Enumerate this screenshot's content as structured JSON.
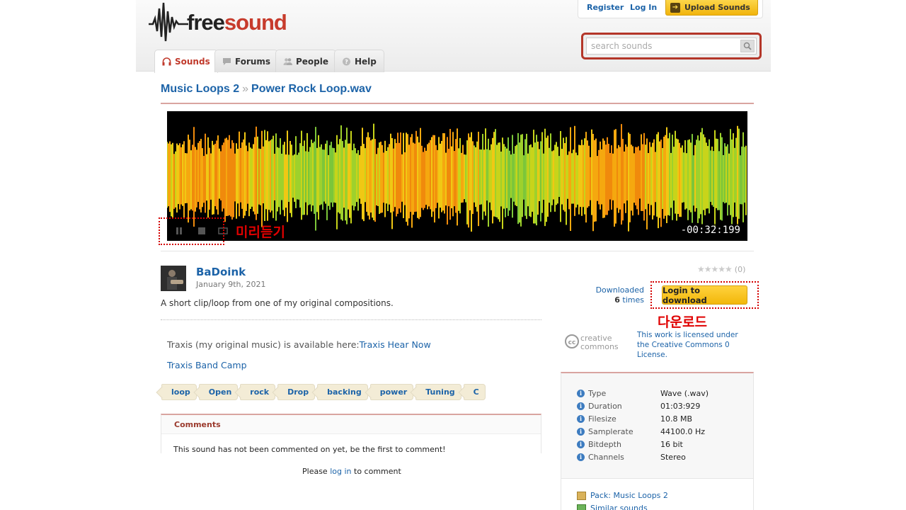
{
  "header": {
    "logo": {
      "word1": "free",
      "word2": "sound"
    },
    "tabs": [
      {
        "label": "Sounds"
      },
      {
        "label": "Forums"
      },
      {
        "label": "People"
      },
      {
        "label": "Help"
      }
    ],
    "register": "Register",
    "login": "Log In",
    "upload": "Upload Sounds",
    "search": {
      "placeholder": "search sounds"
    }
  },
  "breadcrumb": {
    "pack": "Music Loops 2",
    "separator": "»",
    "sound": "Power Rock Loop.wav"
  },
  "player": {
    "time": "-00:32:199",
    "annotation": "미리듣기"
  },
  "sound": {
    "user": "BaDoink",
    "date": "January 9th, 2021",
    "description": "A short clip/loop from one of my original compositions.",
    "traxis_prefix": "Traxis (my original music) is available here:",
    "traxis_link": "Traxis Hear Now",
    "band_camp": "Traxis Band Camp",
    "tags": [
      "loop",
      "Open",
      "rock",
      "Drop",
      "backing",
      "power",
      "Tuning",
      "C"
    ]
  },
  "comments": {
    "title": "Comments",
    "empty": "This sound has not been commented on yet, be the first to comment!",
    "please": "Please",
    "login_link": "log in",
    "to_comment": "to comment"
  },
  "sidebar": {
    "rating_count": "(0)",
    "downloaded_label": "Downloaded",
    "downloaded_count": "6",
    "downloaded_suffix": "times",
    "download_button": "Login to download",
    "download_annotation": "다운로드",
    "license_text": "This work is licensed under the Creative Commons 0 License.",
    "info": [
      {
        "key": "Type",
        "value": "Wave (.wav)"
      },
      {
        "key": "Duration",
        "value": "01:03:929"
      },
      {
        "key": "Filesize",
        "value": "10.8 MB"
      },
      {
        "key": "Samplerate",
        "value": "44100.0 Hz"
      },
      {
        "key": "Bitdepth",
        "value": "16 bit"
      },
      {
        "key": "Channels",
        "value": "Stereo"
      }
    ],
    "pack_link": "Pack: Music Loops 2",
    "similar_link": "Similar sounds"
  },
  "colors": {
    "accent": "#c73b2c",
    "link": "#1c63a8",
    "button": "#f2b70a",
    "annotation": "#e00000"
  }
}
